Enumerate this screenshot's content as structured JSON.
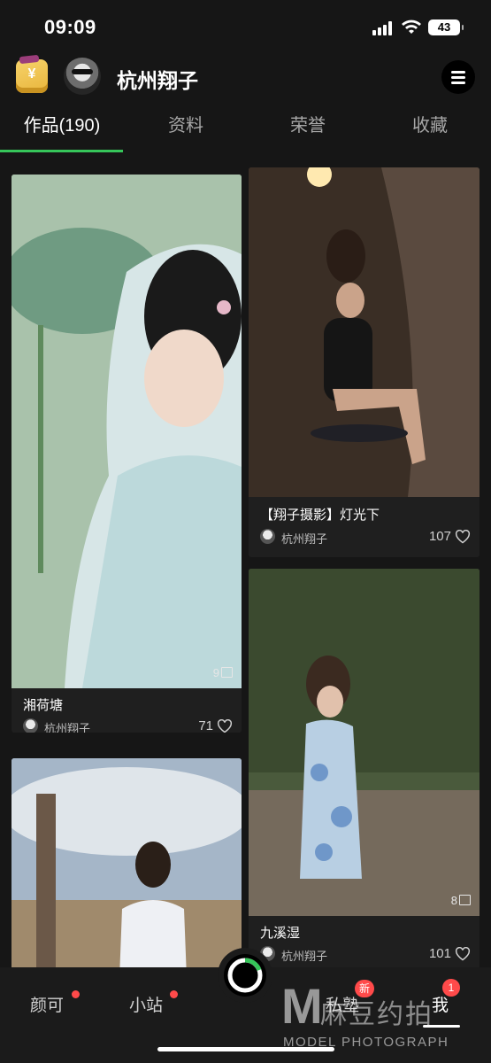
{
  "status_bar": {
    "time": "09:09",
    "battery": "43"
  },
  "header": {
    "wallet_symbol": "¥",
    "username": "杭州翔子"
  },
  "tabs": [
    {
      "label": "作品(190)",
      "active": true
    },
    {
      "label": "资料",
      "active": false
    },
    {
      "label": "荣誉",
      "active": false
    },
    {
      "label": "收藏",
      "active": false
    }
  ],
  "posts": [
    {
      "title": "湘荷塘",
      "author": "杭州翔子",
      "likes": "71",
      "photo_count": "9"
    },
    {
      "title": "【翔子摄影】灯光下",
      "author": "杭州翔子",
      "likes": "107"
    },
    {
      "title": "九溪湿",
      "author": "杭州翔子",
      "likes": "101",
      "photo_count": "8"
    },
    {
      "title": "",
      "author": "",
      "likes": ""
    }
  ],
  "bottom_nav": {
    "items": [
      "颜可",
      "小站",
      "私塾",
      "我"
    ],
    "badge_new": "新",
    "badge_me": "1"
  },
  "watermark": {
    "logo": "M",
    "text": "麻豆约拍",
    "sub": "MODEL PHOTOGRAPH"
  }
}
